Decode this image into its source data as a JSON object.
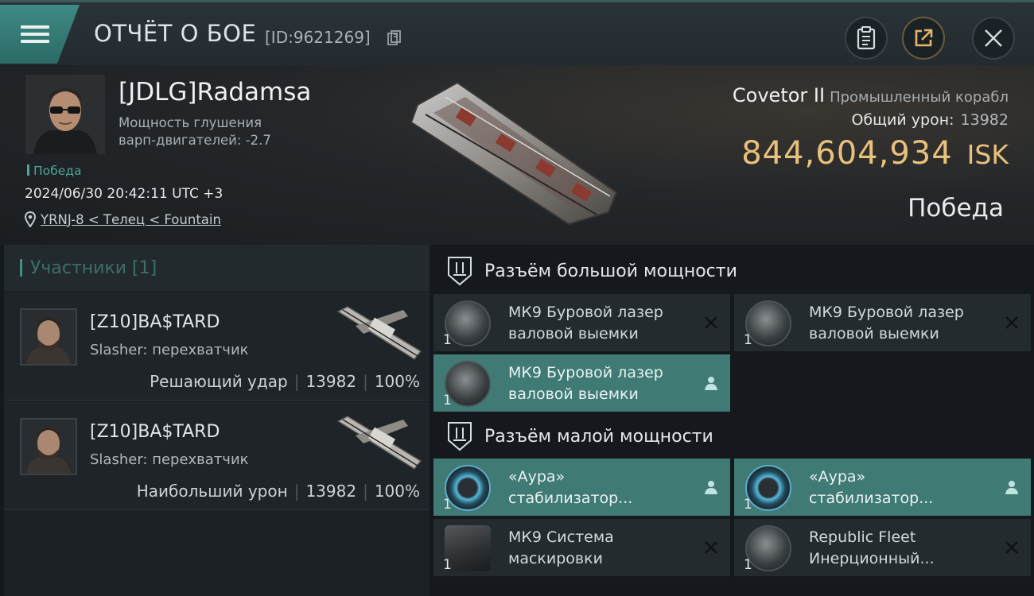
{
  "header": {
    "title": "ОТЧЁТ О БОЕ",
    "report_id": "[ID:9621269]"
  },
  "victim": {
    "pilot_name": "[JDLG]Radamsa",
    "stat_line": "Мощность глушения варп-двигателей: -2.7",
    "result_small": "Победа",
    "timestamp": "2024/06/30 20:42:11 UTC +3",
    "location": "YRNJ-8 < Телец < Fountain",
    "ship_name": "Covetor II",
    "ship_class": "Промышленный корабл",
    "total_damage_label": "Общий урон:",
    "total_damage_value": "13982",
    "isk_value": "844,604,934",
    "isk_unit": "ISK",
    "result_big": "Победа"
  },
  "participants": {
    "header": "Участники [1]",
    "rows": [
      {
        "name": "[Z10]BA$TARD",
        "ship": "Slasher: перехватчик",
        "role": "Решающий удар",
        "damage": "13982",
        "percent": "100%"
      },
      {
        "name": "[Z10]BA$TARD",
        "ship": "Slasher: перехватчик",
        "role": "Наибольший урон",
        "damage": "13982",
        "percent": "100%"
      }
    ]
  },
  "slots": {
    "high": {
      "label": "Разъём большой мощности",
      "items": [
        {
          "name_line1": "МК9 Буровой лазер",
          "name_line2": "валовой выемки",
          "qty": "1",
          "status": "destroyed"
        },
        {
          "name_line1": "МК9 Буровой лазер",
          "name_line2": "валовой выемки",
          "qty": "1",
          "status": "destroyed"
        },
        {
          "name_line1": "МК9 Буровой лазер",
          "name_line2": "валовой выемки",
          "qty": "1",
          "status": "dropped"
        }
      ]
    },
    "low": {
      "label": "Разъём малой мощности",
      "items": [
        {
          "name_line1": "«Аура»",
          "name_line2": "стабилизатор...",
          "qty": "1",
          "status": "dropped"
        },
        {
          "name_line1": "«Аура»",
          "name_line2": "стабилизатор...",
          "qty": "1",
          "status": "dropped"
        },
        {
          "name_line1": "МК9 Система",
          "name_line2": "маскировки",
          "qty": "1",
          "status": "destroyed"
        },
        {
          "name_line1": "Republic Fleet",
          "name_line2": "Инерционный...",
          "qty": "1",
          "status": "destroyed"
        }
      ]
    }
  },
  "colors": {
    "accent_teal": "#3f7a74",
    "isk_gold": "#e9c17c",
    "victory_green": "#4ea69a"
  },
  "icons": [
    "menu-icon",
    "copy-icon",
    "clipboard-icon",
    "share-icon",
    "close-icon",
    "location-pin-icon",
    "slot-high-icon",
    "slot-low-icon",
    "destroyed-x-icon",
    "dropped-person-icon"
  ]
}
